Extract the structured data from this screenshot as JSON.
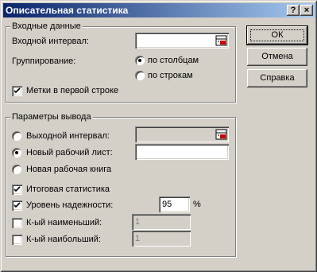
{
  "window": {
    "title": "Описательная статистика",
    "help_label": "?",
    "close_label": "×"
  },
  "input_group": {
    "legend": "Входные данные",
    "input_range_label": "Входной интервал:",
    "input_range_value": "",
    "grouping_label": "Группирование:",
    "by_columns_label": "по столбцам",
    "by_columns_selected": true,
    "by_rows_label": "по строкам",
    "by_rows_selected": false,
    "labels_first_row_label": "Метки в первой строке",
    "labels_first_row_checked": true
  },
  "output_group": {
    "legend": "Параметры вывода",
    "output_range_label": "Выходной интервал:",
    "output_range_value": "",
    "output_range_selected": false,
    "new_sheet_label": "Новый рабочий лист:",
    "new_sheet_value": "",
    "new_sheet_selected": true,
    "new_workbook_label": "Новая рабочая книга",
    "new_workbook_selected": false,
    "summary_stats_label": "Итоговая статистика",
    "summary_stats_checked": true,
    "confidence_label": "Уровень надежности:",
    "confidence_checked": true,
    "confidence_value": "95",
    "confidence_unit": "%",
    "kth_smallest_label": "К-ый наименьший:",
    "kth_smallest_checked": false,
    "kth_smallest_value": "1",
    "kth_largest_label": "К-ый наибольший:",
    "kth_largest_checked": false,
    "kth_largest_value": "1"
  },
  "buttons": {
    "ok_label": "ОК",
    "cancel_label": "Отмена",
    "help_label": "Справка"
  },
  "colors": {
    "title_start": "#0a246a",
    "title_end": "#a6caf0",
    "face": "#d4d0c8",
    "refedit_red": "#cc0000"
  }
}
